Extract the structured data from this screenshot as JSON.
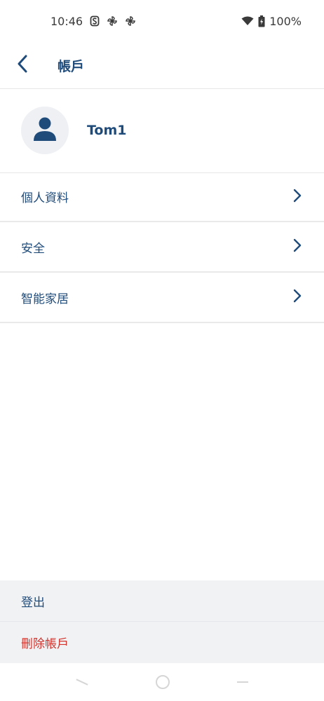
{
  "status_bar": {
    "time": "10:46",
    "battery": "100%",
    "icons": [
      "s-notification-icon",
      "pinwheel-icon",
      "pinwheel-icon",
      "wifi-icon",
      "battery-charging-icon"
    ]
  },
  "app_bar": {
    "title": "帳戶",
    "back_icon": "chevron-left-icon"
  },
  "profile": {
    "username": "Tom1",
    "avatar_icon": "person-icon"
  },
  "menu": {
    "items": [
      {
        "label": "個人資料",
        "icon": "chevron-right-icon"
      },
      {
        "label": "安全",
        "icon": "chevron-right-icon"
      },
      {
        "label": "智能家居",
        "icon": "chevron-right-icon"
      }
    ]
  },
  "actions": {
    "logout": "登出",
    "delete_account": "刪除帳戶"
  },
  "colors": {
    "primary": "#1f4b7a",
    "danger": "#d0342c",
    "action_bg": "#f1f2f4"
  }
}
